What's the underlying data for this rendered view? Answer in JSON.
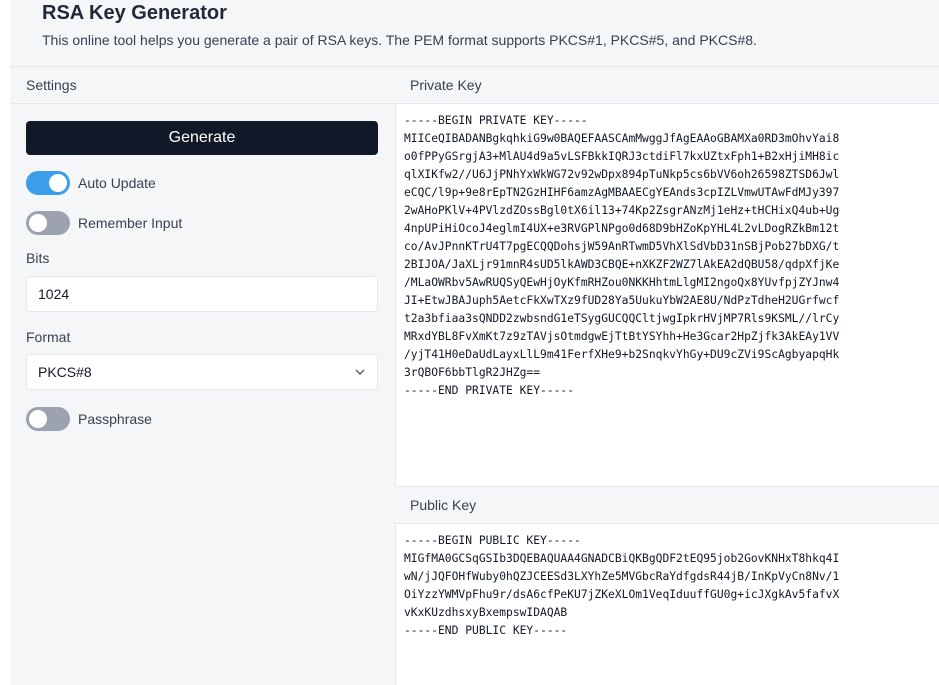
{
  "header": {
    "title": "RSA Key Generator",
    "subtitle": "This online tool helps you generate a pair of RSA keys. The PEM format supports PKCS#1, PKCS#5, and PKCS#8."
  },
  "settings": {
    "heading": "Settings",
    "generate_label": "Generate",
    "auto_update": {
      "label": "Auto Update",
      "on": true
    },
    "remember_input": {
      "label": "Remember Input",
      "on": false
    },
    "bits": {
      "label": "Bits",
      "value": "1024"
    },
    "format": {
      "label": "Format",
      "value": "PKCS#8"
    },
    "passphrase": {
      "label": "Passphrase",
      "on": false
    }
  },
  "private_key": {
    "heading": "Private Key",
    "text": "-----BEGIN PRIVATE KEY-----\nMIICeQIBADANBgkqhkiG9w0BAQEFAASCAmMwggJfAgEAAoGBAMXa0RD3mOhvYai8\no0fPPyGSrgjA3+MlAU4d9a5vLSFBkkIQRJ3ctdiFl7kxUZtxFph1+B2xHjiMH8ic\nqlXIKfw2//U6JjPNhYxWkWG72v92wDpx894pTuNkp5cs6bVV6oh26598ZTSD6Jwl\neCQC/l9p+9e8rEpTN2GzHIHF6amzAgMBAAECgYEAnds3cpIZLVmwUTAwFdMJy397\n2wAHoPKlV+4PVlzdZOssBgl0tX6il13+74Kp2ZsgrANzMj1eHz+tHCHixQ4ub+Ug\n4npUPiHiOcoJ4eglmI4UX+e3RVGPlNPgo0d68D9bHZoKpYHL4L2vLDogRZkBm12t\nco/AvJPnnKTrU4T7pgECQQDohsjW59AnRTwmD5VhXlSdVbD31nSBjPob27bDXG/t\n2BIJOA/JaXLjr91mnR4sUD5lkAWD3CBQE+nXKZF2WZ7lAkEA2dQBU58/qdpXfjKe\n/MLaOWRbv5AwRUQSyQEwHjOyKfmRHZou0NKKHhtmLlgMI2ngoQx8YUvfpjZYJnw4\nJI+EtwJBAJuph5AetcFkXwTXz9fUD28Ya5UukuYbW2AE8U/NdPzTdheH2UGrfwcf\nt2a3bfiaa3sQNDD2zwbsndG1eTSygGUCQQCltjwgIpkrHVjMP7Rls9KSML//lrCy\nMRxdYBL8FvXmKt7z9zTAVjsOtmdgwEjTtBtYSYhh+He3Gcar2HpZjfk3AkEAy1VV\n/yjT41H0eDaUdLayxLlL9m41FerfXHe9+b2SnqkvYhGy+DU9cZVi9ScAgbyapqHk\n3rQBOF6bbTlgR2JHZg==\n-----END PRIVATE KEY-----"
  },
  "public_key": {
    "heading": "Public Key",
    "text": "-----BEGIN PUBLIC KEY-----\nMIGfMA0GCSqGSIb3DQEBAQUAA4GNADCBiQKBgQDF2tEQ95job2GovKNHxT8hkq4I\nwN/jJQFOHfWuby0hQZJCEESd3LXYhZe5MVGbcRaYdfgdsR44jB/InKpVyCn8Nv/1\nOiYzzYWMVpFhu9r/dsA6cfPeKU7jZKeXLOm1VeqIduuffGU0g+icJXgkAv5fafvX\nvKxKUzdhsxyBxempswIDAQAB\n-----END PUBLIC KEY-----"
  }
}
